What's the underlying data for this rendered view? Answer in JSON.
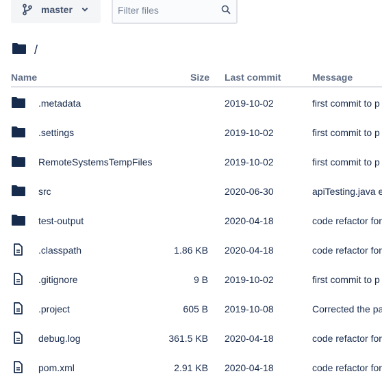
{
  "toolbar": {
    "branch_label": "master",
    "filter_placeholder": "Filter files"
  },
  "breadcrumb": {
    "separator": "/"
  },
  "table": {
    "headers": {
      "name": "Name",
      "size": "Size",
      "last_commit": "Last commit",
      "message": "Message"
    },
    "rows": [
      {
        "type": "folder",
        "name": ".metadata",
        "size": "",
        "date": "2019-10-02",
        "message": "first commit to p"
      },
      {
        "type": "folder",
        "name": ".settings",
        "size": "",
        "date": "2019-10-02",
        "message": "first commit to p"
      },
      {
        "type": "folder",
        "name": "RemoteSystemsTempFiles",
        "size": "",
        "date": "2019-10-02",
        "message": "first commit to p"
      },
      {
        "type": "folder",
        "name": "src",
        "size": "",
        "date": "2020-06-30",
        "message": "apiTesting.java e"
      },
      {
        "type": "folder",
        "name": "test-output",
        "size": "",
        "date": "2020-04-18",
        "message": "code refactor for"
      },
      {
        "type": "file",
        "name": ".classpath",
        "size": "1.86 KB",
        "date": "2020-04-18",
        "message": "code refactor for"
      },
      {
        "type": "file",
        "name": ".gitignore",
        "size": "9 B",
        "date": "2019-10-02",
        "message": "first commit to p"
      },
      {
        "type": "file",
        "name": ".project",
        "size": "605 B",
        "date": "2019-10-08",
        "message": "Corrected the pa"
      },
      {
        "type": "file",
        "name": "debug.log",
        "size": "361.5 KB",
        "date": "2020-04-18",
        "message": "code refactor for"
      },
      {
        "type": "file",
        "name": "pom.xml",
        "size": "2.91 KB",
        "date": "2020-04-18",
        "message": "code refactor for"
      }
    ]
  },
  "colors": {
    "text": "#172b4d",
    "header_text": "#5e6c84",
    "icon": "#172b4d",
    "button_bg": "#f4f5f7",
    "border": "#dfe1e6"
  }
}
